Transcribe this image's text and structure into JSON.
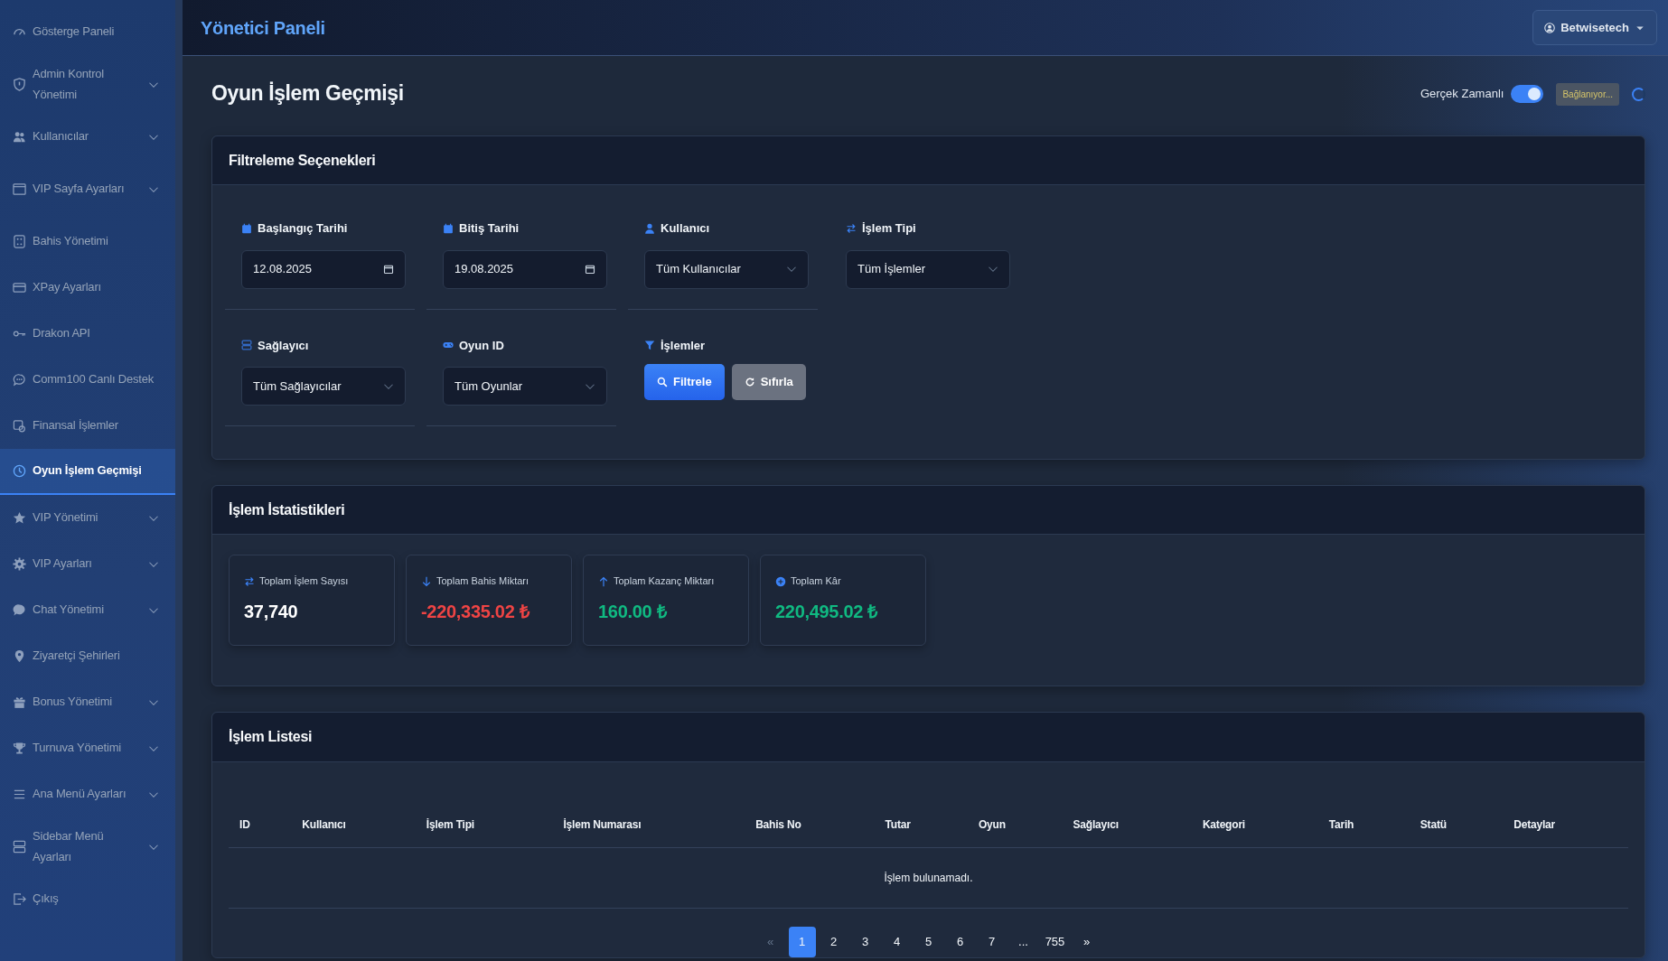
{
  "sidebar": {
    "items": [
      {
        "label": "Gösterge Paneli",
        "expandable": false,
        "selected": false
      },
      {
        "label": "Admin Kontrol Yönetimi",
        "expandable": true,
        "selected": false
      },
      {
        "label": "Kullanıcılar",
        "expandable": true,
        "selected": false
      },
      {
        "label": "VIP Sayfa Ayarları",
        "expandable": true,
        "selected": false
      },
      {
        "label": "Bahis Yönetimi",
        "expandable": false,
        "selected": false
      },
      {
        "label": "XPay Ayarları",
        "expandable": false,
        "selected": false
      },
      {
        "label": "Drakon API",
        "expandable": false,
        "selected": false
      },
      {
        "label": "Comm100 Canlı Destek",
        "expandable": false,
        "selected": false
      },
      {
        "label": "Finansal İşlemler",
        "expandable": false,
        "selected": false
      },
      {
        "label": "Oyun İşlem Geçmişi",
        "expandable": false,
        "selected": true
      },
      {
        "label": "VIP Yönetimi",
        "expandable": true,
        "selected": false
      },
      {
        "label": "VIP Ayarları",
        "expandable": true,
        "selected": false
      },
      {
        "label": "Chat Yönetimi",
        "expandable": true,
        "selected": false
      },
      {
        "label": "Ziyaretçi Şehirleri",
        "expandable": false,
        "selected": false
      },
      {
        "label": "Bonus Yönetimi",
        "expandable": true,
        "selected": false
      },
      {
        "label": "Turnuva Yönetimi",
        "expandable": true,
        "selected": false
      },
      {
        "label": "Ana Menü Ayarları",
        "expandable": true,
        "selected": false
      },
      {
        "label": "Sidebar Menü Ayarları",
        "expandable": true,
        "selected": false
      },
      {
        "label": "Çıkış",
        "expandable": false,
        "selected": false
      }
    ]
  },
  "header": {
    "title": "Yönetici Paneli",
    "user_menu": "Betwisetech"
  },
  "page": {
    "title": "Oyun İşlem Geçmişi",
    "realtime": {
      "label": "Gerçek Zamanlı",
      "on": true
    },
    "connection_status": "Bağlanıyor..."
  },
  "filters": {
    "title": "Filtreleme Seçenekleri",
    "fields": [
      {
        "kind": "date",
        "label": "Başlangıç Tarihi",
        "value": "12.08.2025"
      },
      {
        "kind": "date",
        "label": "Bitiş Tarihi",
        "value": "19.08.2025"
      },
      {
        "kind": "select",
        "label": "Kullanıcı",
        "value": "Tüm Kullanıcılar"
      },
      {
        "kind": "select",
        "label": "İşlem Tipi",
        "value": "Tüm İşlemler"
      },
      {
        "kind": "select",
        "label": "Sağlayıcı",
        "value": "Tüm Sağlayıcılar"
      },
      {
        "kind": "select",
        "label": "Oyun ID",
        "value": "Tüm Oyunlar"
      }
    ],
    "actions": {
      "label": "İşlemler",
      "buttons": [
        {
          "kind": "primary",
          "label": "Filtrele"
        },
        {
          "kind": "secondary",
          "label": "Sıfırla"
        }
      ]
    }
  },
  "stats": {
    "title": "İşlem İstatistikleri",
    "items": [
      {
        "label": "Toplam İşlem Sayısı",
        "value": "37,740",
        "color": "#ffffff"
      },
      {
        "label": "Toplam Bahis Miktarı",
        "value": "-220,335.02 ₺",
        "color": "#ef4444"
      },
      {
        "label": "Toplam Kazanç Miktarı",
        "value": "160.00 ₺",
        "color": "#10b981"
      },
      {
        "label": "Toplam Kâr",
        "value": "220,495.02 ₺",
        "color": "#10b981"
      }
    ]
  },
  "table": {
    "title": "İşlem Listesi",
    "columns": [
      "ID",
      "Kullanıcı",
      "İşlem Tipi",
      "İşlem Numarası",
      "Bahis No",
      "Tutar",
      "Oyun",
      "Sağlayıcı",
      "Kategori",
      "Tarih",
      "Statü",
      "Detaylar"
    ],
    "empty_message": "İşlem bulunamadı."
  },
  "pagination": [
    {
      "label": "«",
      "selected": false,
      "disabled": true
    },
    {
      "label": "1",
      "selected": true,
      "disabled": false
    },
    {
      "label": "2",
      "selected": false,
      "disabled": false
    },
    {
      "label": "3",
      "selected": false,
      "disabled": false
    },
    {
      "label": "4",
      "selected": false,
      "disabled": false
    },
    {
      "label": "5",
      "selected": false,
      "disabled": false
    },
    {
      "label": "6",
      "selected": false,
      "disabled": false
    },
    {
      "label": "7",
      "selected": false,
      "disabled": false
    },
    {
      "label": "...",
      "selected": false,
      "disabled": false
    },
    {
      "label": "755",
      "selected": false,
      "disabled": false
    },
    {
      "label": "»",
      "selected": false,
      "disabled": false
    }
  ]
}
